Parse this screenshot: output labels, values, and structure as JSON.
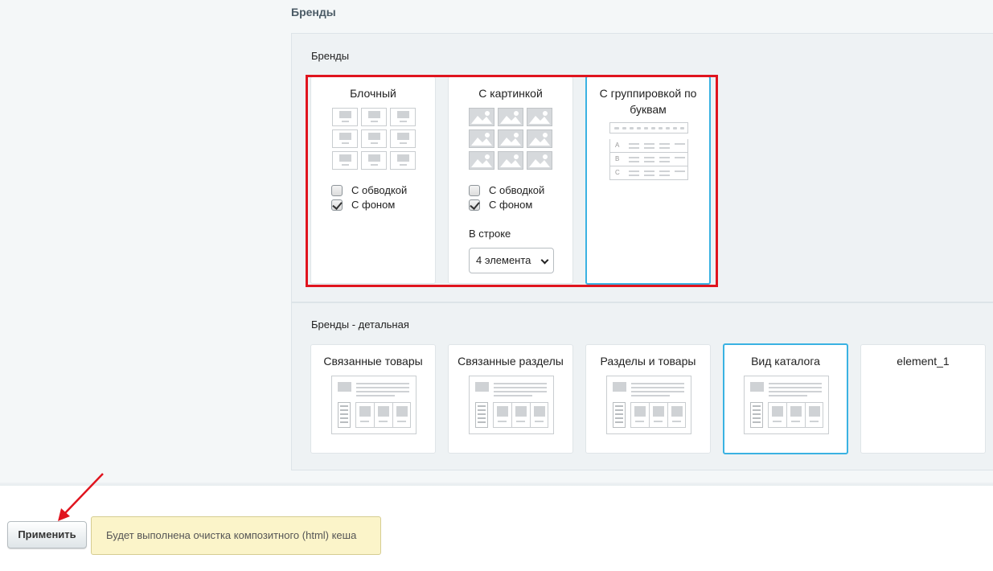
{
  "section_title": "Бренды",
  "brands": {
    "title": "Бренды",
    "cards": [
      {
        "title": "Блочный",
        "options": [
          {
            "label": "С обводкой",
            "checked": false
          },
          {
            "label": "С фоном",
            "checked": true
          }
        ]
      },
      {
        "title": "С картинкой",
        "options": [
          {
            "label": "С обводкой",
            "checked": false
          },
          {
            "label": "С фоном",
            "checked": true
          }
        ],
        "in_row_label": "В строке",
        "in_row_value": "4 элемента"
      },
      {
        "title": "С группировкой по буквам",
        "letters": [
          "A",
          "B",
          "C"
        ],
        "selected": true
      }
    ]
  },
  "brands_detail": {
    "title": "Бренды - детальная",
    "cards": [
      {
        "title": "Связанные товары"
      },
      {
        "title": "Связанные разделы"
      },
      {
        "title": "Разделы и товары"
      },
      {
        "title": "Вид каталога",
        "selected": true
      },
      {
        "title": "element_1"
      }
    ]
  },
  "footer": {
    "apply_label": "Применить",
    "notice": "Будет выполнена очистка композитного (html) кеша"
  },
  "colors": {
    "selected_border": "#3ab2e2",
    "highlight_box": "#e0141e",
    "notice_bg": "#fbf4c9"
  }
}
